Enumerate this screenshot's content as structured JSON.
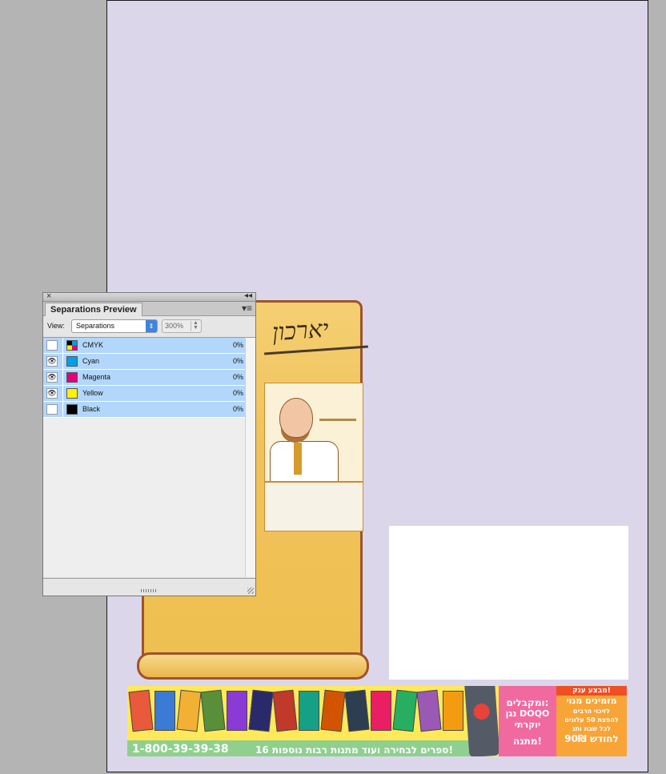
{
  "panel": {
    "title": "Separations Preview",
    "close_icon": "×",
    "collapse_icon": "◂◂",
    "menu_icon": "▾≡",
    "view_label": "View:",
    "view_value": "Separations",
    "zoom_value": "300%",
    "separations": [
      {
        "name": "CMYK",
        "percent": "0%",
        "visible": false,
        "eye": "",
        "color": "multi"
      },
      {
        "name": "Cyan",
        "percent": "0%",
        "visible": true,
        "eye": "👁",
        "color": "#00a0e9"
      },
      {
        "name": "Magenta",
        "percent": "0%",
        "visible": true,
        "eye": "👁",
        "color": "#e4007f"
      },
      {
        "name": "Yellow",
        "percent": "0%",
        "visible": true,
        "eye": "👁",
        "color": "#fff100"
      },
      {
        "name": "Black",
        "percent": "0%",
        "visible": false,
        "eye": "",
        "color": "#000000"
      }
    ]
  },
  "artwork": {
    "scroll_title": "יארכון",
    "banner": {
      "phone": "1-800-39-39-38",
      "offer": "16 ספרים לבחירה ועוד מתנות רבות נוספות!",
      "pink_lines": [
        "ומקבלים:",
        "נגן DOQO",
        "יוקרתי",
        "מתנה!"
      ],
      "orange_header": "מבצע ענק!",
      "orange_lines": [
        "מזמינים מנוי",
        "לזיכוי הרבים",
        "להפצת 50 עלונים",
        "לכל שבת ותג",
        "90₪ לחודש"
      ]
    }
  },
  "colors": {
    "page_bg": "#dcd6ea",
    "canvas_bg": "#b4b4b4",
    "row_highlight": "#b3d7fb"
  }
}
